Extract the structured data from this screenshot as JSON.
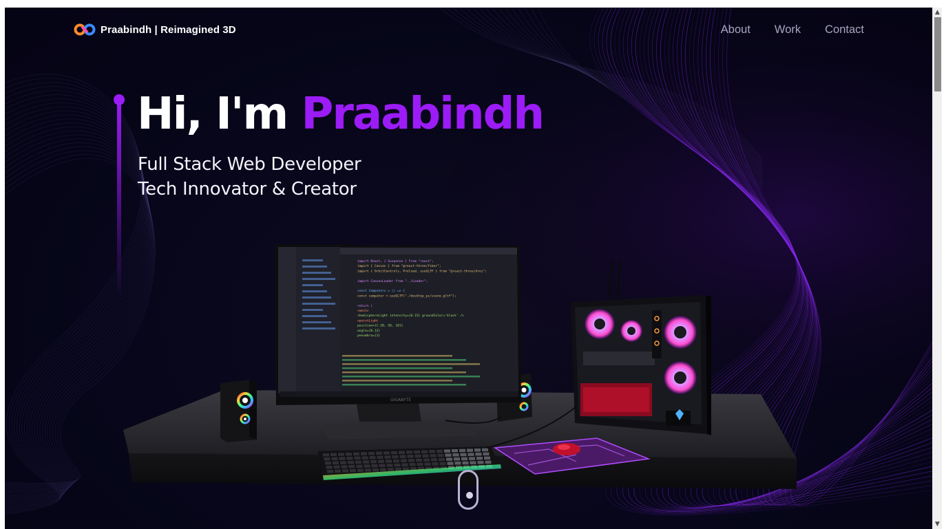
{
  "nav": {
    "brand_text": "Praabindh | Reimagined 3D",
    "links": [
      "About",
      "Work",
      "Contact"
    ]
  },
  "hero": {
    "greeting": "Hi, I'm ",
    "name": "Praabindh",
    "subtitle_lines": [
      "Full Stack Web Developer",
      "Tech Innovator & Creator"
    ]
  },
  "scene": {
    "monitor_brand": "GIGABYTE",
    "code_lines": [
      "import React, { Suspense } from \"react\";",
      "import { Canvas } from \"@react-three/fiber\";",
      "import { OrbitControls, Preload, useGLTF } from \"@react-three/drei\";",
      "",
      "import CanvasLoader from \"../Loader\";",
      "",
      "const Computers = () => {",
      "  const computer = useGLTF(\"./desktop_pc/scene.gltf\");",
      "",
      "  return (",
      "    <mesh>",
      "      <hemisphereLight intensity={0.15} groundColor='black' />",
      "      <pointLight",
      "        position={[-20, 50, 10]}",
      "        angle={0.12}",
      "        penumbra={1}"
    ]
  },
  "colors": {
    "background": "#07061a",
    "accent": "#9b1cf6",
    "nav_link": "#a9a4be",
    "wave": "#8b2cf5"
  },
  "icons": {
    "brand": "infinity-logo-icon",
    "scroll": "mouse-scroll-icon"
  }
}
